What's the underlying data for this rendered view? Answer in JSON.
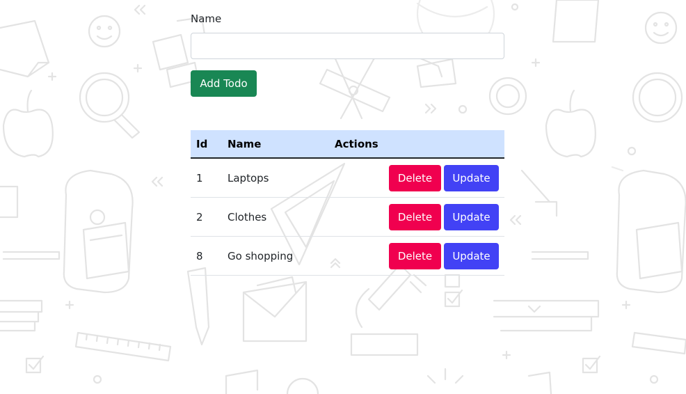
{
  "form": {
    "name_label": "Name",
    "name_value": "",
    "name_placeholder": "",
    "add_button_label": "Add Todo"
  },
  "table": {
    "headers": {
      "id": "Id",
      "name": "Name",
      "actions": "Actions"
    },
    "rows": [
      {
        "id": "1",
        "name": "Laptops",
        "delete_label": "Delete",
        "update_label": "Update"
      },
      {
        "id": "2",
        "name": "Clothes",
        "delete_label": "Delete",
        "update_label": "Update"
      },
      {
        "id": "8",
        "name": "Go shopping",
        "delete_label": "Delete",
        "update_label": "Update"
      }
    ]
  },
  "colors": {
    "add_button": "#198754",
    "delete_button": "#f0004f",
    "update_button": "#4242f5",
    "table_header": "#cfe2ff",
    "doodle_stroke": "#e3e3e3"
  }
}
